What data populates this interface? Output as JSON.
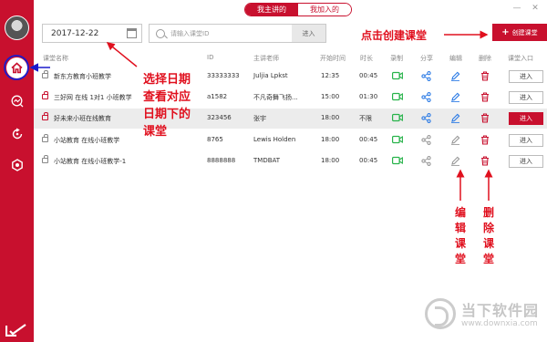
{
  "tabs": {
    "hosted": "我主讲的",
    "joined": "我加入的"
  },
  "toolbar": {
    "date_value": "2017-12-22",
    "search_placeholder": "请输入课堂ID",
    "search_button": "进入",
    "create_button": "创建课堂"
  },
  "columns": {
    "name": "课堂名称",
    "id": "ID",
    "teacher": "主讲老师",
    "start": "开始时间",
    "duration": "时长",
    "record": "录制",
    "share": "分享",
    "edit": "编辑",
    "delete": "删除",
    "entry": "课堂入口"
  },
  "rows": [
    {
      "name": "新东方教育小班教学",
      "id": "33333333",
      "teacher": "Juljia Lpkst",
      "start": "12:35",
      "duration": "00:45",
      "enter": "进入",
      "active": false,
      "lock_red": false
    },
    {
      "name": "三好网 在线 1对1 小班教学",
      "id": "a1582",
      "teacher": "不凡奇舞飞扬...",
      "start": "15:00",
      "duration": "01:30",
      "enter": "进入",
      "active": false,
      "lock_red": true
    },
    {
      "name": "好未来小班在线教育",
      "id": "323456",
      "teacher": "张宇",
      "start": "18:00",
      "duration": "不限",
      "enter": "进入",
      "active": true,
      "lock_red": true
    },
    {
      "name": "小站教育 在线小班教学",
      "id": "8765",
      "teacher": "Lewis Holden",
      "start": "18:00",
      "duration": "00:45",
      "enter": "进入",
      "active": false,
      "lock_red": false
    },
    {
      "name": "小站教育 在线小班教学-1",
      "id": "8888888",
      "teacher": "TMDBAT",
      "start": "18:00",
      "duration": "00:45",
      "enter": "进入",
      "active": false,
      "lock_red": false
    }
  ],
  "annotations": {
    "date_note": [
      "选择日期",
      "查看对应",
      "日期下的",
      "课堂"
    ],
    "create_note": "点击创建课堂",
    "edit_note": [
      "编",
      "辑",
      "课",
      "堂"
    ],
    "delete_note": [
      "删",
      "除",
      "课",
      "堂"
    ]
  },
  "watermark": {
    "title": "当下软件园",
    "url": "www.downxia.com"
  },
  "colors": {
    "brand": "#c8102e",
    "record_green": "#27b34a",
    "share_blue": "#2c7be5",
    "annotation_red": "#e0101e"
  },
  "icons": {
    "sidebar": [
      "home-icon",
      "chart-icon",
      "refresh-icon",
      "settings-hex-icon"
    ],
    "row": [
      "lock-icon",
      "video-icon",
      "share-icon",
      "pencil-icon",
      "trash-icon"
    ]
  }
}
